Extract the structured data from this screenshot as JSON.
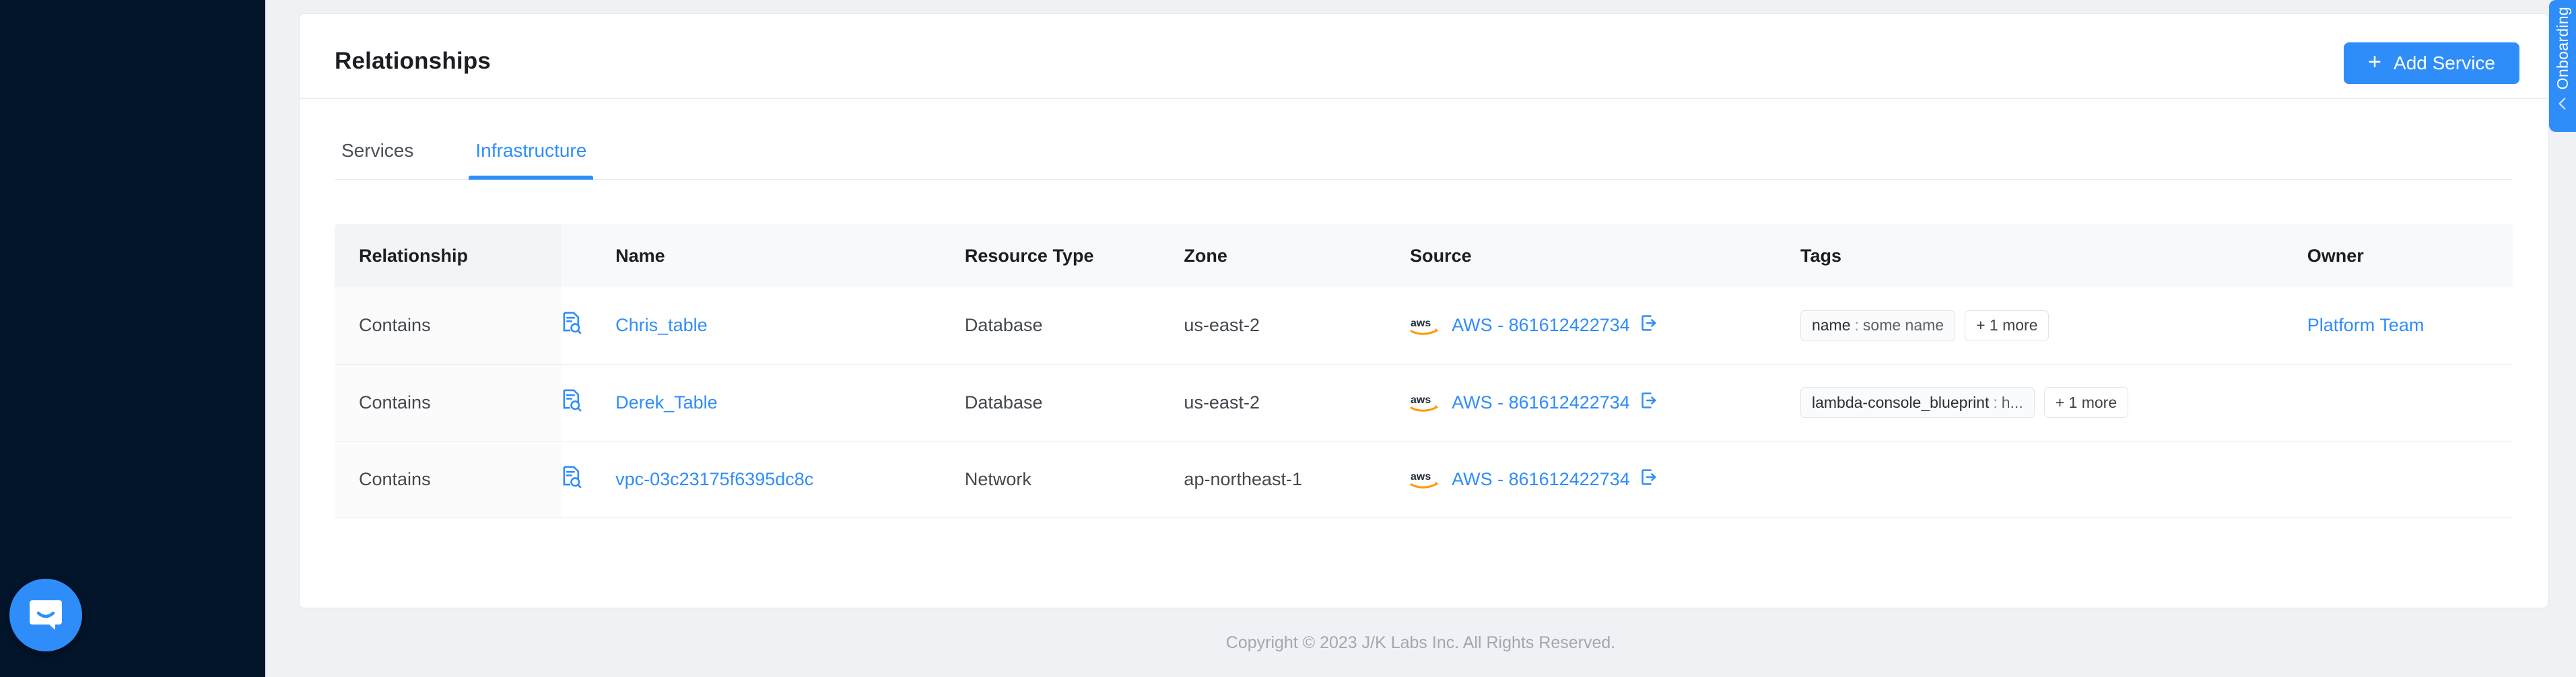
{
  "theme": {
    "accent": "#2f8dfa",
    "sidebar_bg": "#02152b",
    "page_bg": "#eff1f5",
    "card_bg": "#ffffff",
    "table_header_bg": "#f3f4f6"
  },
  "header": {
    "title": "Relationships",
    "add_service_label": "Add Service",
    "add_service_plus": "+"
  },
  "tabs": [
    {
      "label": "Services",
      "active": false
    },
    {
      "label": "Infrastructure",
      "active": true
    }
  ],
  "table": {
    "columns": [
      "Relationship",
      "",
      "Name",
      "Resource Type",
      "Zone",
      "Source",
      "Tags",
      "Owner"
    ],
    "rows": [
      {
        "relationship": "Contains",
        "icon": "document-search-icon",
        "name": "Chris_table",
        "resource_type": "Database",
        "zone": "us-east-2",
        "source": {
          "logo": "aws-logo",
          "label": "AWS - 861612422734",
          "link_icon": "external-link-icon"
        },
        "tags": [
          {
            "key": "name",
            "sep": ":",
            "value": "some name"
          }
        ],
        "tags_more": "+ 1 more",
        "owner": "Platform Team"
      },
      {
        "relationship": "Contains",
        "icon": "document-search-icon",
        "name": "Derek_Table",
        "resource_type": "Database",
        "zone": "us-east-2",
        "source": {
          "logo": "aws-logo",
          "label": "AWS - 861612422734",
          "link_icon": "external-link-icon"
        },
        "tags": [
          {
            "key": "lambda-console_blueprint",
            "sep": ":",
            "value": "h..."
          }
        ],
        "tags_more": "+ 1 more",
        "owner": ""
      },
      {
        "relationship": "Contains",
        "icon": "document-search-icon",
        "name": "vpc-03c23175f6395dc8c",
        "resource_type": "Network",
        "zone": "ap-northeast-1",
        "source": {
          "logo": "aws-logo",
          "label": "AWS - 861612422734",
          "link_icon": "external-link-icon"
        },
        "tags": [],
        "tags_more": "",
        "owner": ""
      }
    ]
  },
  "footer": {
    "copyright": "Copyright © 2023 J/K Labs Inc. All Rights Reserved."
  },
  "onboarding": {
    "label": "Onboarding",
    "chevron_icon": "chevron-left-icon"
  },
  "chat": {
    "launcher_icon": "intercom-chat-icon"
  }
}
